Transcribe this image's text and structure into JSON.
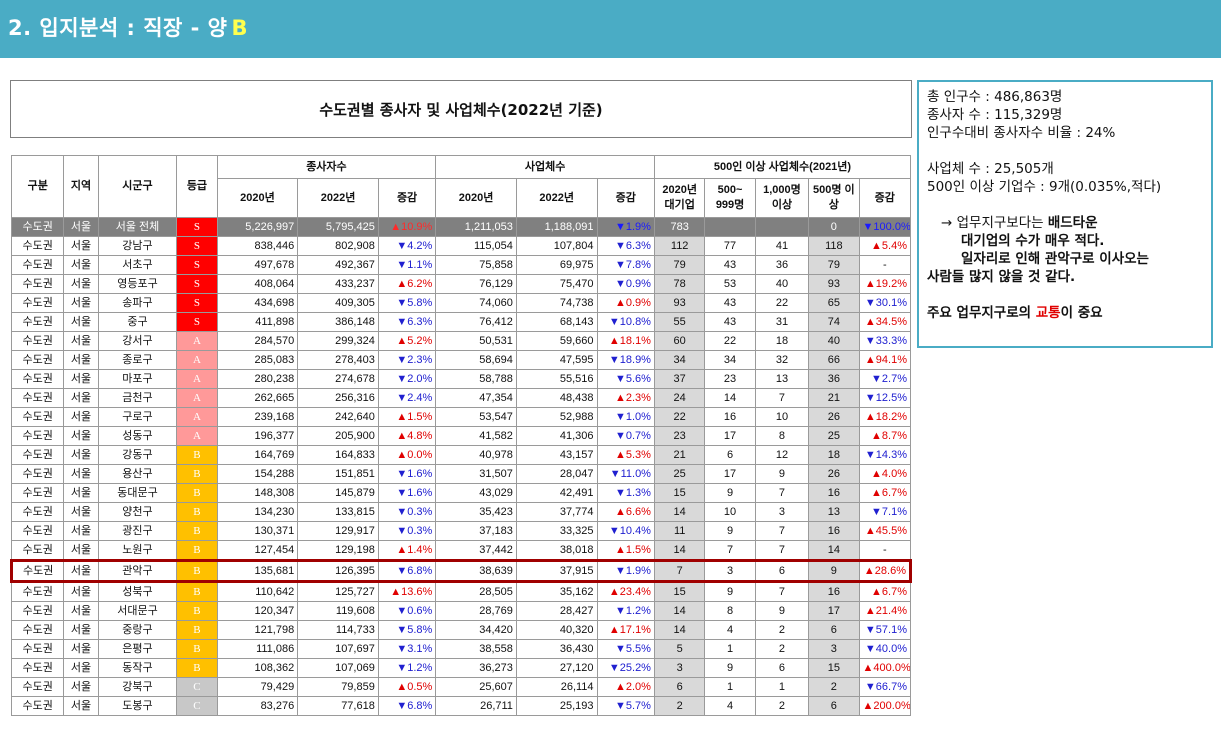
{
  "header": {
    "title": "2. 입지분석 : 직장 - 양",
    "grade": "B"
  },
  "table": {
    "title": "수도권별 종사자 및 사업체수(2022년 기준)",
    "headers": {
      "gubun": "구분",
      "region": "지역",
      "sigungu": "시군구",
      "grade": "등급",
      "workers": "종사자수",
      "biz": "사업체수",
      "large": "500인 이상 사업체수(2021년)",
      "y2020": "2020년",
      "y2022": "2022년",
      "change": "증감",
      "large2020": "2020년 대기업",
      "l500": "500~ 999명",
      "l1000": "1,000명 이상",
      "l500b": "500명 이상",
      "lchange": "증감"
    },
    "total": {
      "gubun": "수도권",
      "region": "서울",
      "name": "서울 전체",
      "grade": "S",
      "w2020": "5,226,997",
      "w2022": "5,795,425",
      "wchg": "▲10.9%",
      "wdir": "up",
      "b2020": "1,211,053",
      "b2022": "1,188,091",
      "bchg": "▼1.9%",
      "bdir": "down",
      "l2020": "783",
      "l500": "",
      "l1000": "",
      "l500b": "0",
      "lchg": "▼100.0%",
      "ldir": "down"
    },
    "rows": [
      {
        "gubun": "수도권",
        "region": "서울",
        "name": "강남구",
        "grade": "S",
        "w2020": "838,446",
        "w2022": "802,908",
        "wchg": "▼4.2%",
        "wdir": "down",
        "b2020": "115,054",
        "b2022": "107,804",
        "bchg": "▼6.3%",
        "bdir": "down",
        "l2020": "112",
        "l500": "77",
        "l1000": "41",
        "l500b": "118",
        "lchg": "▲5.4%",
        "ldir": "up"
      },
      {
        "gubun": "수도권",
        "region": "서울",
        "name": "서초구",
        "grade": "S",
        "w2020": "497,678",
        "w2022": "492,367",
        "wchg": "▼1.1%",
        "wdir": "down",
        "b2020": "75,858",
        "b2022": "69,975",
        "bchg": "▼7.8%",
        "bdir": "down",
        "l2020": "79",
        "l500": "43",
        "l1000": "36",
        "l500b": "79",
        "lchg": "-",
        "ldir": "none"
      },
      {
        "gubun": "수도권",
        "region": "서울",
        "name": "영등포구",
        "grade": "S",
        "w2020": "408,064",
        "w2022": "433,237",
        "wchg": "▲6.2%",
        "wdir": "up",
        "b2020": "76,129",
        "b2022": "75,470",
        "bchg": "▼0.9%",
        "bdir": "down",
        "l2020": "78",
        "l500": "53",
        "l1000": "40",
        "l500b": "93",
        "lchg": "▲19.2%",
        "ldir": "up"
      },
      {
        "gubun": "수도권",
        "region": "서울",
        "name": "송파구",
        "grade": "S",
        "w2020": "434,698",
        "w2022": "409,305",
        "wchg": "▼5.8%",
        "wdir": "down",
        "b2020": "74,060",
        "b2022": "74,738",
        "bchg": "▲0.9%",
        "bdir": "up",
        "l2020": "93",
        "l500": "43",
        "l1000": "22",
        "l500b": "65",
        "lchg": "▼30.1%",
        "ldir": "down"
      },
      {
        "gubun": "수도권",
        "region": "서울",
        "name": "중구",
        "grade": "S",
        "w2020": "411,898",
        "w2022": "386,148",
        "wchg": "▼6.3%",
        "wdir": "down",
        "b2020": "76,412",
        "b2022": "68,143",
        "bchg": "▼10.8%",
        "bdir": "down",
        "l2020": "55",
        "l500": "43",
        "l1000": "31",
        "l500b": "74",
        "lchg": "▲34.5%",
        "ldir": "up"
      },
      {
        "gubun": "수도권",
        "region": "서울",
        "name": "강서구",
        "grade": "A",
        "w2020": "284,570",
        "w2022": "299,324",
        "wchg": "▲5.2%",
        "wdir": "up",
        "b2020": "50,531",
        "b2022": "59,660",
        "bchg": "▲18.1%",
        "bdir": "up",
        "l2020": "60",
        "l500": "22",
        "l1000": "18",
        "l500b": "40",
        "lchg": "▼33.3%",
        "ldir": "down"
      },
      {
        "gubun": "수도권",
        "region": "서울",
        "name": "종로구",
        "grade": "A",
        "w2020": "285,083",
        "w2022": "278,403",
        "wchg": "▼2.3%",
        "wdir": "down",
        "b2020": "58,694",
        "b2022": "47,595",
        "bchg": "▼18.9%",
        "bdir": "down",
        "l2020": "34",
        "l500": "34",
        "l1000": "32",
        "l500b": "66",
        "lchg": "▲94.1%",
        "ldir": "up"
      },
      {
        "gubun": "수도권",
        "region": "서울",
        "name": "마포구",
        "grade": "A",
        "w2020": "280,238",
        "w2022": "274,678",
        "wchg": "▼2.0%",
        "wdir": "down",
        "b2020": "58,788",
        "b2022": "55,516",
        "bchg": "▼5.6%",
        "bdir": "down",
        "l2020": "37",
        "l500": "23",
        "l1000": "13",
        "l500b": "36",
        "lchg": "▼2.7%",
        "ldir": "down"
      },
      {
        "gubun": "수도권",
        "region": "서울",
        "name": "금천구",
        "grade": "A",
        "w2020": "262,665",
        "w2022": "256,316",
        "wchg": "▼2.4%",
        "wdir": "down",
        "b2020": "47,354",
        "b2022": "48,438",
        "bchg": "▲2.3%",
        "bdir": "up",
        "l2020": "24",
        "l500": "14",
        "l1000": "7",
        "l500b": "21",
        "lchg": "▼12.5%",
        "ldir": "down"
      },
      {
        "gubun": "수도권",
        "region": "서울",
        "name": "구로구",
        "grade": "A",
        "w2020": "239,168",
        "w2022": "242,640",
        "wchg": "▲1.5%",
        "wdir": "up",
        "b2020": "53,547",
        "b2022": "52,988",
        "bchg": "▼1.0%",
        "bdir": "down",
        "l2020": "22",
        "l500": "16",
        "l1000": "10",
        "l500b": "26",
        "lchg": "▲18.2%",
        "ldir": "up"
      },
      {
        "gubun": "수도권",
        "region": "서울",
        "name": "성동구",
        "grade": "A",
        "w2020": "196,377",
        "w2022": "205,900",
        "wchg": "▲4.8%",
        "wdir": "up",
        "b2020": "41,582",
        "b2022": "41,306",
        "bchg": "▼0.7%",
        "bdir": "down",
        "l2020": "23",
        "l500": "17",
        "l1000": "8",
        "l500b": "25",
        "lchg": "▲8.7%",
        "ldir": "up"
      },
      {
        "gubun": "수도권",
        "region": "서울",
        "name": "강동구",
        "grade": "B",
        "w2020": "164,769",
        "w2022": "164,833",
        "wchg": "▲0.0%",
        "wdir": "up",
        "b2020": "40,978",
        "b2022": "43,157",
        "bchg": "▲5.3%",
        "bdir": "up",
        "l2020": "21",
        "l500": "6",
        "l1000": "12",
        "l500b": "18",
        "lchg": "▼14.3%",
        "ldir": "down"
      },
      {
        "gubun": "수도권",
        "region": "서울",
        "name": "용산구",
        "grade": "B",
        "w2020": "154,288",
        "w2022": "151,851",
        "wchg": "▼1.6%",
        "wdir": "down",
        "b2020": "31,507",
        "b2022": "28,047",
        "bchg": "▼11.0%",
        "bdir": "down",
        "l2020": "25",
        "l500": "17",
        "l1000": "9",
        "l500b": "26",
        "lchg": "▲4.0%",
        "ldir": "up"
      },
      {
        "gubun": "수도권",
        "region": "서울",
        "name": "동대문구",
        "grade": "B",
        "w2020": "148,308",
        "w2022": "145,879",
        "wchg": "▼1.6%",
        "wdir": "down",
        "b2020": "43,029",
        "b2022": "42,491",
        "bchg": "▼1.3%",
        "bdir": "down",
        "l2020": "15",
        "l500": "9",
        "l1000": "7",
        "l500b": "16",
        "lchg": "▲6.7%",
        "ldir": "up"
      },
      {
        "gubun": "수도권",
        "region": "서울",
        "name": "양천구",
        "grade": "B",
        "w2020": "134,230",
        "w2022": "133,815",
        "wchg": "▼0.3%",
        "wdir": "down",
        "b2020": "35,423",
        "b2022": "37,774",
        "bchg": "▲6.6%",
        "bdir": "up",
        "l2020": "14",
        "l500": "10",
        "l1000": "3",
        "l500b": "13",
        "lchg": "▼7.1%",
        "ldir": "down"
      },
      {
        "gubun": "수도권",
        "region": "서울",
        "name": "광진구",
        "grade": "B",
        "w2020": "130,371",
        "w2022": "129,917",
        "wchg": "▼0.3%",
        "wdir": "down",
        "b2020": "37,183",
        "b2022": "33,325",
        "bchg": "▼10.4%",
        "bdir": "down",
        "l2020": "11",
        "l500": "9",
        "l1000": "7",
        "l500b": "16",
        "lchg": "▲45.5%",
        "ldir": "up"
      },
      {
        "gubun": "수도권",
        "region": "서울",
        "name": "노원구",
        "grade": "B",
        "w2020": "127,454",
        "w2022": "129,198",
        "wchg": "▲1.4%",
        "wdir": "up",
        "b2020": "37,442",
        "b2022": "38,018",
        "bchg": "▲1.5%",
        "bdir": "up",
        "l2020": "14",
        "l500": "7",
        "l1000": "7",
        "l500b": "14",
        "lchg": "-",
        "ldir": "none"
      },
      {
        "gubun": "수도권",
        "region": "서울",
        "name": "관악구",
        "grade": "B",
        "w2020": "135,681",
        "w2022": "126,395",
        "wchg": "▼6.8%",
        "wdir": "down",
        "b2020": "38,639",
        "b2022": "37,915",
        "bchg": "▼1.9%",
        "bdir": "down",
        "l2020": "7",
        "l500": "3",
        "l1000": "6",
        "l500b": "9",
        "lchg": "▲28.6%",
        "ldir": "up",
        "highlight": true
      },
      {
        "gubun": "수도권",
        "region": "서울",
        "name": "성북구",
        "grade": "B",
        "w2020": "110,642",
        "w2022": "125,727",
        "wchg": "▲13.6%",
        "wdir": "up",
        "b2020": "28,505",
        "b2022": "35,162",
        "bchg": "▲23.4%",
        "bdir": "up",
        "l2020": "15",
        "l500": "9",
        "l1000": "7",
        "l500b": "16",
        "lchg": "▲6.7%",
        "ldir": "up"
      },
      {
        "gubun": "수도권",
        "region": "서울",
        "name": "서대문구",
        "grade": "B",
        "w2020": "120,347",
        "w2022": "119,608",
        "wchg": "▼0.6%",
        "wdir": "down",
        "b2020": "28,769",
        "b2022": "28,427",
        "bchg": "▼1.2%",
        "bdir": "down",
        "l2020": "14",
        "l500": "8",
        "l1000": "9",
        "l500b": "17",
        "lchg": "▲21.4%",
        "ldir": "up"
      },
      {
        "gubun": "수도권",
        "region": "서울",
        "name": "중랑구",
        "grade": "B",
        "w2020": "121,798",
        "w2022": "114,733",
        "wchg": "▼5.8%",
        "wdir": "down",
        "b2020": "34,420",
        "b2022": "40,320",
        "bchg": "▲17.1%",
        "bdir": "up",
        "l2020": "14",
        "l500": "4",
        "l1000": "2",
        "l500b": "6",
        "lchg": "▼57.1%",
        "ldir": "down"
      },
      {
        "gubun": "수도권",
        "region": "서울",
        "name": "은평구",
        "grade": "B",
        "w2020": "111,086",
        "w2022": "107,697",
        "wchg": "▼3.1%",
        "wdir": "down",
        "b2020": "38,558",
        "b2022": "36,430",
        "bchg": "▼5.5%",
        "bdir": "down",
        "l2020": "5",
        "l500": "1",
        "l1000": "2",
        "l500b": "3",
        "lchg": "▼40.0%",
        "ldir": "down"
      },
      {
        "gubun": "수도권",
        "region": "서울",
        "name": "동작구",
        "grade": "B",
        "w2020": "108,362",
        "w2022": "107,069",
        "wchg": "▼1.2%",
        "wdir": "down",
        "b2020": "36,273",
        "b2022": "27,120",
        "bchg": "▼25.2%",
        "bdir": "down",
        "l2020": "3",
        "l500": "9",
        "l1000": "6",
        "l500b": "15",
        "lchg": "▲400.0%",
        "ldir": "up"
      },
      {
        "gubun": "수도권",
        "region": "서울",
        "name": "강북구",
        "grade": "C",
        "w2020": "79,429",
        "w2022": "79,859",
        "wchg": "▲0.5%",
        "wdir": "up",
        "b2020": "25,607",
        "b2022": "26,114",
        "bchg": "▲2.0%",
        "bdir": "up",
        "l2020": "6",
        "l500": "1",
        "l1000": "1",
        "l500b": "2",
        "lchg": "▼66.7%",
        "ldir": "down"
      },
      {
        "gubun": "수도권",
        "region": "서울",
        "name": "도봉구",
        "grade": "C",
        "w2020": "83,276",
        "w2022": "77,618",
        "wchg": "▼6.8%",
        "wdir": "down",
        "b2020": "26,711",
        "b2022": "25,193",
        "bchg": "▼5.7%",
        "bdir": "down",
        "l2020": "2",
        "l500": "4",
        "l1000": "2",
        "l500b": "6",
        "lchg": "▲200.0%",
        "ldir": "up"
      }
    ]
  },
  "note": {
    "line1": "총 인구수 : 486,863명",
    "line2": "종사자 수 : 115,329명",
    "line3": "인구수대비 종사자수 비율 : 24%",
    "line4": "사업체 수 : 25,505개",
    "line5": "500인 이상 기업수 : 9개(0.035%,적다)",
    "p1_a": "→ 업무지구보다는 ",
    "p1_b": "배드타운",
    "p1_c": "대기업의 수가 매우 적다.",
    "p2_a": "일자리로 인해 관악구로 이사오는",
    "p2_b": "사람들 많지 않을 것 같다.",
    "p3_a": "주요 업무지구로의 ",
    "p3_b": "교통",
    "p3_c": "이 중요"
  }
}
